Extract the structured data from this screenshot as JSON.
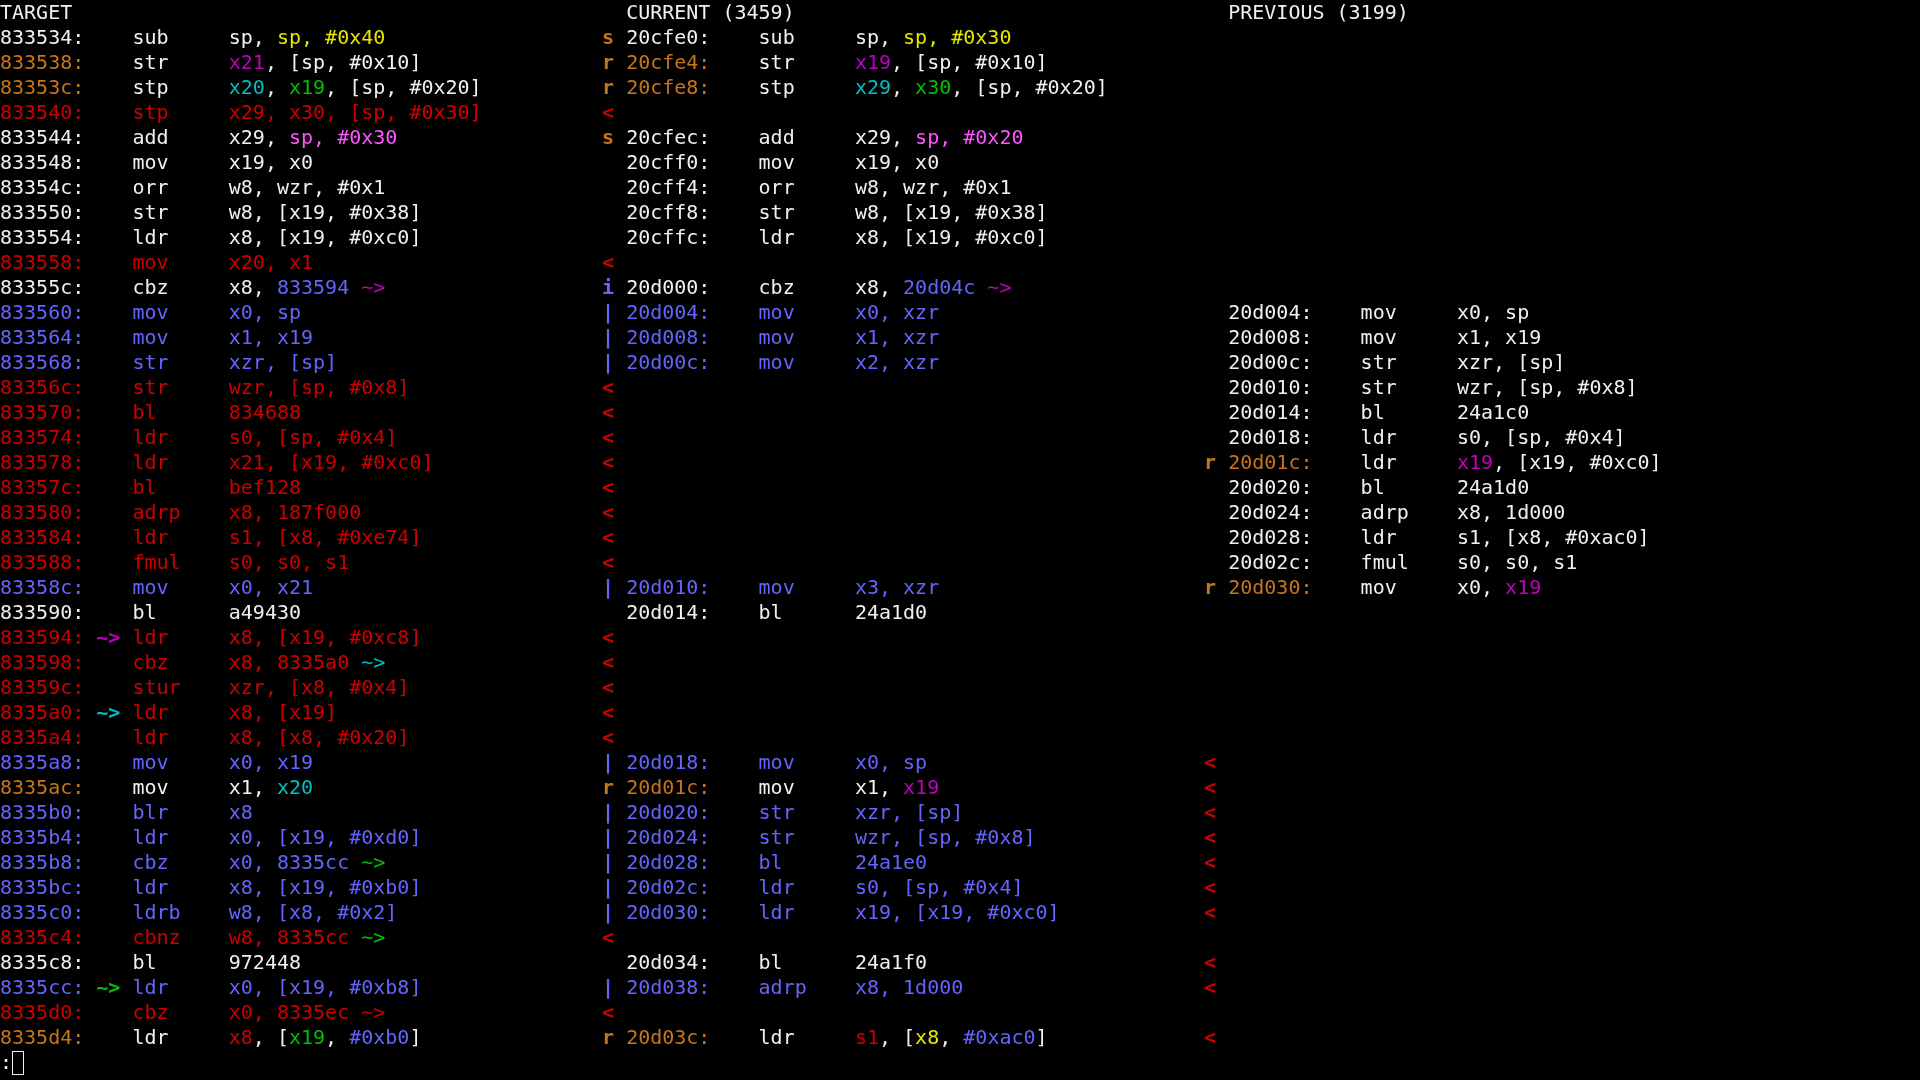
{
  "headers": [
    "TARGET",
    "CURRENT (3459)",
    "PREVIOUS (3199)"
  ],
  "rows": [
    {
      "target": {
        "kind": "same",
        "address": "833534:",
        "mnemonic": "sub",
        "operands": [
          "sp, ",
          {
            "text": "sp, #0x40",
            "color": "#e6e600"
          }
        ]
      },
      "current": {
        "marker": {
          "text": "s",
          "color": "#c8741a"
        },
        "kind": "same",
        "address": "20cfe0:",
        "mnemonic": "sub",
        "operands": [
          "sp, ",
          {
            "text": "sp, #0x30",
            "color": "#e6e600"
          }
        ]
      }
    },
    {
      "target": {
        "kind": "changed",
        "address": "833538:",
        "mnemonic": "str",
        "operands": [
          {
            "text": "x21",
            "color": "#c000c0"
          },
          ", [sp, #0x10]"
        ]
      },
      "current": {
        "marker": {
          "text": "r",
          "color": "#c8741a"
        },
        "kind": "changed",
        "address": "20cfe4:",
        "mnemonic": "str",
        "operands": [
          {
            "text": "x19",
            "color": "#c000c0"
          },
          ", [sp, #0x10]"
        ]
      }
    },
    {
      "target": {
        "kind": "changed",
        "address": "83353c:",
        "mnemonic": "stp",
        "operands": [
          {
            "text": "x20",
            "color": "#00c0c0"
          },
          ", ",
          {
            "text": "x19",
            "color": "#00c000"
          },
          ", [sp, #0x20]"
        ]
      },
      "current": {
        "marker": {
          "text": "r",
          "color": "#c8741a"
        },
        "kind": "changed",
        "address": "20cfe8:",
        "mnemonic": "stp",
        "operands": [
          {
            "text": "x29",
            "color": "#00c0c0"
          },
          ", ",
          {
            "text": "x30",
            "color": "#00c000"
          },
          ", [sp, #0x20]"
        ]
      }
    },
    {
      "target": {
        "kind": "deleted",
        "address": "833540:",
        "mnemonic": "stp",
        "operands": [
          "x29, x30, [sp, #0x30]"
        ]
      },
      "current": {
        "marker": {
          "text": "<",
          "color": "#cc0000"
        }
      }
    },
    {
      "target": {
        "kind": "same",
        "address": "833544:",
        "mnemonic": "add",
        "operands": [
          "x29, ",
          {
            "text": "sp, #0x30",
            "color": "#ff55ff"
          }
        ]
      },
      "current": {
        "marker": {
          "text": "s",
          "color": "#c8741a"
        },
        "kind": "same",
        "address": "20cfec:",
        "mnemonic": "add",
        "operands": [
          "x29, ",
          {
            "text": "sp, #0x20",
            "color": "#ff55ff"
          }
        ]
      }
    },
    {
      "target": {
        "kind": "same",
        "address": "833548:",
        "mnemonic": "mov",
        "operands": [
          "x19, x0"
        ]
      },
      "current": {
        "kind": "same",
        "address": "20cff0:",
        "mnemonic": "mov",
        "operands": [
          "x19, x0"
        ]
      }
    },
    {
      "target": {
        "kind": "same",
        "address": "83354c:",
        "mnemonic": "orr",
        "operands": [
          "w8, wzr, #0x1"
        ]
      },
      "current": {
        "kind": "same",
        "address": "20cff4:",
        "mnemonic": "orr",
        "operands": [
          "w8, wzr, #0x1"
        ]
      }
    },
    {
      "target": {
        "kind": "same",
        "address": "833550:",
        "mnemonic": "str",
        "operands": [
          "w8, [x19, #0x38]"
        ]
      },
      "current": {
        "kind": "same",
        "address": "20cff8:",
        "mnemonic": "str",
        "operands": [
          "w8, [x19, #0x38]"
        ]
      }
    },
    {
      "target": {
        "kind": "same",
        "address": "833554:",
        "mnemonic": "ldr",
        "operands": [
          "x8, [x19, #0xc0]"
        ]
      },
      "current": {
        "kind": "same",
        "address": "20cffc:",
        "mnemonic": "ldr",
        "operands": [
          "x8, [x19, #0xc0]"
        ]
      }
    },
    {
      "target": {
        "kind": "deleted",
        "address": "833558:",
        "mnemonic": "mov",
        "operands": [
          "x20, x1"
        ]
      },
      "current": {
        "marker": {
          "text": "<",
          "color": "#cc0000"
        }
      }
    },
    {
      "target": {
        "kind": "same",
        "address": "83355c:",
        "mnemonic": "cbz",
        "operands": [
          "x8, ",
          {
            "text": "833594",
            "color": "#6464ff"
          },
          {
            "text": " ~>",
            "color": "#c000c0"
          }
        ]
      },
      "current": {
        "marker": {
          "text": "i",
          "color": "#6464ff"
        },
        "kind": "same",
        "address": "20d000:",
        "mnemonic": "cbz",
        "operands": [
          "x8, ",
          {
            "text": "20d04c",
            "color": "#6464ff"
          },
          {
            "text": " ~>",
            "color": "#c000c0"
          }
        ]
      }
    },
    {
      "target": {
        "kind": "inserted",
        "address": "833560:",
        "mnemonic": "mov",
        "operands": [
          "x0, sp"
        ]
      },
      "current": {
        "marker": {
          "text": "|",
          "color": "#6464ff"
        },
        "kind": "inserted",
        "address": "20d004:",
        "mnemonic": "mov",
        "operands": [
          "x0, xzr"
        ]
      },
      "previous": {
        "kind": "same",
        "address": "20d004:",
        "mnemonic": "mov",
        "operands": [
          "x0, sp"
        ]
      }
    },
    {
      "target": {
        "kind": "inserted",
        "address": "833564:",
        "mnemonic": "mov",
        "operands": [
          "x1, x19"
        ]
      },
      "current": {
        "marker": {
          "text": "|",
          "color": "#6464ff"
        },
        "kind": "inserted",
        "address": "20d008:",
        "mnemonic": "mov",
        "operands": [
          "x1, xzr"
        ]
      },
      "previous": {
        "kind": "same",
        "address": "20d008:",
        "mnemonic": "mov",
        "operands": [
          "x1, x19"
        ]
      }
    },
    {
      "target": {
        "kind": "inserted",
        "address": "833568:",
        "mnemonic": "str",
        "operands": [
          "xzr, [sp]"
        ]
      },
      "current": {
        "marker": {
          "text": "|",
          "color": "#6464ff"
        },
        "kind": "inserted",
        "address": "20d00c:",
        "mnemonic": "mov",
        "operands": [
          "x2, xzr"
        ]
      },
      "previous": {
        "kind": "same",
        "address": "20d00c:",
        "mnemonic": "str",
        "operands": [
          "xzr, [sp]"
        ]
      }
    },
    {
      "target": {
        "kind": "deleted",
        "address": "83356c:",
        "mnemonic": "str",
        "operands": [
          "wzr, [sp, #0x8]"
        ]
      },
      "current": {
        "marker": {
          "text": "<",
          "color": "#cc0000"
        }
      },
      "previous": {
        "kind": "same",
        "address": "20d010:",
        "mnemonic": "str",
        "operands": [
          "wzr, [sp, #0x8]"
        ]
      }
    },
    {
      "target": {
        "kind": "deleted",
        "address": "833570:",
        "mnemonic": "bl",
        "operands": [
          "834688"
        ]
      },
      "current": {
        "marker": {
          "text": "<",
          "color": "#cc0000"
        }
      },
      "previous": {
        "kind": "same",
        "address": "20d014:",
        "mnemonic": "bl",
        "operands": [
          "24a1c0"
        ]
      }
    },
    {
      "target": {
        "kind": "deleted",
        "address": "833574:",
        "mnemonic": "ldr",
        "operands": [
          "s0, [sp, #0x4]"
        ]
      },
      "current": {
        "marker": {
          "text": "<",
          "color": "#cc0000"
        }
      },
      "previous": {
        "kind": "same",
        "address": "20d018:",
        "mnemonic": "ldr",
        "operands": [
          "s0, [sp, #0x4]"
        ]
      }
    },
    {
      "target": {
        "kind": "deleted",
        "address": "833578:",
        "mnemonic": "ldr",
        "operands": [
          "x21, [x19, #0xc0]"
        ]
      },
      "current": {
        "marker": {
          "text": "<",
          "color": "#cc0000"
        }
      },
      "previous": {
        "marker": {
          "text": "r",
          "color": "#c8741a"
        },
        "kind": "changed",
        "address": "20d01c:",
        "mnemonic": "ldr",
        "operands": [
          {
            "text": "x19",
            "color": "#c000c0"
          },
          ", [x19, #0xc0]"
        ]
      }
    },
    {
      "target": {
        "kind": "deleted",
        "address": "83357c:",
        "mnemonic": "bl",
        "operands": [
          "bef128"
        ]
      },
      "current": {
        "marker": {
          "text": "<",
          "color": "#cc0000"
        }
      },
      "previous": {
        "kind": "same",
        "address": "20d020:",
        "mnemonic": "bl",
        "operands": [
          "24a1d0"
        ]
      }
    },
    {
      "target": {
        "kind": "deleted",
        "address": "833580:",
        "mnemonic": "adrp",
        "operands": [
          "x8, 187f000"
        ]
      },
      "current": {
        "marker": {
          "text": "<",
          "color": "#cc0000"
        }
      },
      "previous": {
        "kind": "same",
        "address": "20d024:",
        "mnemonic": "adrp",
        "operands": [
          "x8, 1d000"
        ]
      }
    },
    {
      "target": {
        "kind": "deleted",
        "address": "833584:",
        "mnemonic": "ldr",
        "operands": [
          "s1, [x8, #0xe74]"
        ]
      },
      "current": {
        "marker": {
          "text": "<",
          "color": "#cc0000"
        }
      },
      "previous": {
        "kind": "same",
        "address": "20d028:",
        "mnemonic": "ldr",
        "operands": [
          "s1, [x8, #0xac0]"
        ]
      }
    },
    {
      "target": {
        "kind": "deleted",
        "address": "833588:",
        "mnemonic": "fmul",
        "operands": [
          "s0, s0, s1"
        ]
      },
      "current": {
        "marker": {
          "text": "<",
          "color": "#cc0000"
        }
      },
      "previous": {
        "kind": "same",
        "address": "20d02c:",
        "mnemonic": "fmul",
        "operands": [
          "s0, s0, s1"
        ]
      }
    },
    {
      "target": {
        "kind": "inserted",
        "address": "83358c:",
        "mnemonic": "mov",
        "operands": [
          "x0, x21"
        ]
      },
      "current": {
        "marker": {
          "text": "|",
          "color": "#6464ff"
        },
        "kind": "inserted",
        "address": "20d010:",
        "mnemonic": "mov",
        "operands": [
          "x3, xzr"
        ]
      },
      "previous": {
        "marker": {
          "text": "r",
          "color": "#c8741a"
        },
        "kind": "changed",
        "address": "20d030:",
        "mnemonic": "mov",
        "operands": [
          "x0, ",
          {
            "text": "x19",
            "color": "#c000c0"
          }
        ]
      }
    },
    {
      "target": {
        "kind": "same",
        "address": "833590:",
        "mnemonic": "bl",
        "operands": [
          "a49430"
        ]
      },
      "current": {
        "kind": "same",
        "address": "20d014:",
        "mnemonic": "bl",
        "operands": [
          "24a1d0"
        ]
      }
    },
    {
      "target": {
        "kind": "deleted",
        "address": "833594:",
        "branch": {
          "text": "~>",
          "color": "#c000c0"
        },
        "mnemonic": "ldr",
        "operands": [
          "x8, [x19, #0xc8]"
        ]
      },
      "current": {
        "marker": {
          "text": "<",
          "color": "#cc0000"
        }
      }
    },
    {
      "target": {
        "kind": "deleted",
        "address": "833598:",
        "mnemonic": "cbz",
        "operands": [
          "x8, 8335a0",
          {
            "text": " ~>",
            "color": "#00c0c0"
          }
        ]
      },
      "current": {
        "marker": {
          "text": "<",
          "color": "#cc0000"
        }
      }
    },
    {
      "target": {
        "kind": "deleted",
        "address": "83359c:",
        "mnemonic": "stur",
        "operands": [
          "xzr, [x8, #0x4]"
        ]
      },
      "current": {
        "marker": {
          "text": "<",
          "color": "#cc0000"
        }
      }
    },
    {
      "target": {
        "kind": "deleted",
        "address": "8335a0:",
        "branch": {
          "text": "~>",
          "color": "#00c0c0"
        },
        "mnemonic": "ldr",
        "operands": [
          "x8, [x19]"
        ]
      },
      "current": {
        "marker": {
          "text": "<",
          "color": "#cc0000"
        }
      }
    },
    {
      "target": {
        "kind": "deleted",
        "address": "8335a4:",
        "mnemonic": "ldr",
        "operands": [
          "x8, [x8, #0x20]"
        ]
      },
      "current": {
        "marker": {
          "text": "<",
          "color": "#cc0000"
        }
      }
    },
    {
      "target": {
        "kind": "inserted",
        "address": "8335a8:",
        "mnemonic": "mov",
        "operands": [
          "x0, x19"
        ]
      },
      "current": {
        "marker": {
          "text": "|",
          "color": "#6464ff"
        },
        "kind": "inserted",
        "address": "20d018:",
        "mnemonic": "mov",
        "operands": [
          "x0, sp"
        ]
      },
      "previous": {
        "marker": {
          "text": "<",
          "color": "#cc0000"
        }
      }
    },
    {
      "target": {
        "kind": "changed",
        "address": "8335ac:",
        "mnemonic": "mov",
        "operands": [
          "x1, ",
          {
            "text": "x20",
            "color": "#00c0c0"
          }
        ]
      },
      "current": {
        "marker": {
          "text": "r",
          "color": "#c8741a"
        },
        "kind": "changed",
        "address": "20d01c:",
        "mnemonic": "mov",
        "operands": [
          "x1, ",
          {
            "text": "x19",
            "color": "#c000c0"
          }
        ]
      },
      "previous": {
        "marker": {
          "text": "<",
          "color": "#cc0000"
        }
      }
    },
    {
      "target": {
        "kind": "inserted",
        "address": "8335b0:",
        "mnemonic": "blr",
        "operands": [
          "x8"
        ]
      },
      "current": {
        "marker": {
          "text": "|",
          "color": "#6464ff"
        },
        "kind": "inserted",
        "address": "20d020:",
        "mnemonic": "str",
        "operands": [
          "xzr, [sp]"
        ]
      },
      "previous": {
        "marker": {
          "text": "<",
          "color": "#cc0000"
        }
      }
    },
    {
      "target": {
        "kind": "inserted",
        "address": "8335b4:",
        "mnemonic": "ldr",
        "operands": [
          "x0, [x19, #0xd0]"
        ]
      },
      "current": {
        "marker": {
          "text": "|",
          "color": "#6464ff"
        },
        "kind": "inserted",
        "address": "20d024:",
        "mnemonic": "str",
        "operands": [
          "wzr, [sp, #0x8]"
        ]
      },
      "previous": {
        "marker": {
          "text": "<",
          "color": "#cc0000"
        }
      }
    },
    {
      "target": {
        "kind": "inserted",
        "address": "8335b8:",
        "mnemonic": "cbz",
        "operands": [
          "x0, 8335cc",
          {
            "text": " ~>",
            "color": "#00c000"
          }
        ]
      },
      "current": {
        "marker": {
          "text": "|",
          "color": "#6464ff"
        },
        "kind": "inserted",
        "address": "20d028:",
        "mnemonic": "bl",
        "operands": [
          "24a1e0"
        ]
      },
      "previous": {
        "marker": {
          "text": "<",
          "color": "#cc0000"
        }
      }
    },
    {
      "target": {
        "kind": "inserted",
        "address": "8335bc:",
        "mnemonic": "ldr",
        "operands": [
          "x8, [x19, #0xb0]"
        ]
      },
      "current": {
        "marker": {
          "text": "|",
          "color": "#6464ff"
        },
        "kind": "inserted",
        "address": "20d02c:",
        "mnemonic": "ldr",
        "operands": [
          "s0, [sp, #0x4]"
        ]
      },
      "previous": {
        "marker": {
          "text": "<",
          "color": "#cc0000"
        }
      }
    },
    {
      "target": {
        "kind": "inserted",
        "address": "8335c0:",
        "mnemonic": "ldrb",
        "operands": [
          "w8, [x8, #0x2]"
        ]
      },
      "current": {
        "marker": {
          "text": "|",
          "color": "#6464ff"
        },
        "kind": "inserted",
        "address": "20d030:",
        "mnemonic": "ldr",
        "operands": [
          "x19, [x19, #0xc0]"
        ]
      },
      "previous": {
        "marker": {
          "text": "<",
          "color": "#cc0000"
        }
      }
    },
    {
      "target": {
        "kind": "deleted",
        "address": "8335c4:",
        "mnemonic": "cbnz",
        "operands": [
          "w8, 8335cc",
          {
            "text": " ~>",
            "color": "#00c000"
          }
        ]
      },
      "current": {
        "marker": {
          "text": "<",
          "color": "#cc0000"
        }
      }
    },
    {
      "target": {
        "kind": "same",
        "address": "8335c8:",
        "mnemonic": "bl",
        "operands": [
          "972448"
        ]
      },
      "current": {
        "kind": "same",
        "address": "20d034:",
        "mnemonic": "bl",
        "operands": [
          "24a1f0"
        ]
      },
      "previous": {
        "marker": {
          "text": "<",
          "color": "#cc0000"
        }
      }
    },
    {
      "target": {
        "kind": "inserted",
        "address": "8335cc:",
        "branch": {
          "text": "~>",
          "color": "#00c000"
        },
        "mnemonic": "ldr",
        "operands": [
          "x0, [x19, #0xb8]"
        ]
      },
      "current": {
        "marker": {
          "text": "|",
          "color": "#6464ff"
        },
        "kind": "inserted",
        "address": "20d038:",
        "mnemonic": "adrp",
        "operands": [
          "x8, 1d000"
        ]
      },
      "previous": {
        "marker": {
          "text": "<",
          "color": "#cc0000"
        }
      }
    },
    {
      "target": {
        "kind": "deleted",
        "address": "8335d0:",
        "mnemonic": "cbz",
        "operands": [
          "x0, 8335ec ~>"
        ]
      },
      "current": {
        "marker": {
          "text": "<",
          "color": "#cc0000"
        }
      }
    },
    {
      "target": {
        "kind": "changed",
        "address": "8335d4:",
        "mnemonic": "ldr",
        "operands": [
          {
            "text": "x8",
            "color": "#cc0000"
          },
          ", [",
          {
            "text": "x19",
            "color": "#00c000"
          },
          ", ",
          {
            "text": "#0xb0",
            "color": "#6464ff"
          },
          "]"
        ]
      },
      "current": {
        "marker": {
          "text": "r",
          "color": "#c8741a"
        },
        "kind": "changed",
        "address": "20d03c:",
        "mnemonic": "ldr",
        "operands": [
          {
            "text": "s1",
            "color": "#cc0000"
          },
          ", [",
          {
            "text": "x8",
            "color": "#e6e600"
          },
          ", ",
          {
            "text": "#0xac0",
            "color": "#6464ff"
          },
          "]"
        ]
      },
      "previous": {
        "marker": {
          "text": "<",
          "color": "#cc0000"
        }
      }
    }
  ],
  "prompt": ":"
}
